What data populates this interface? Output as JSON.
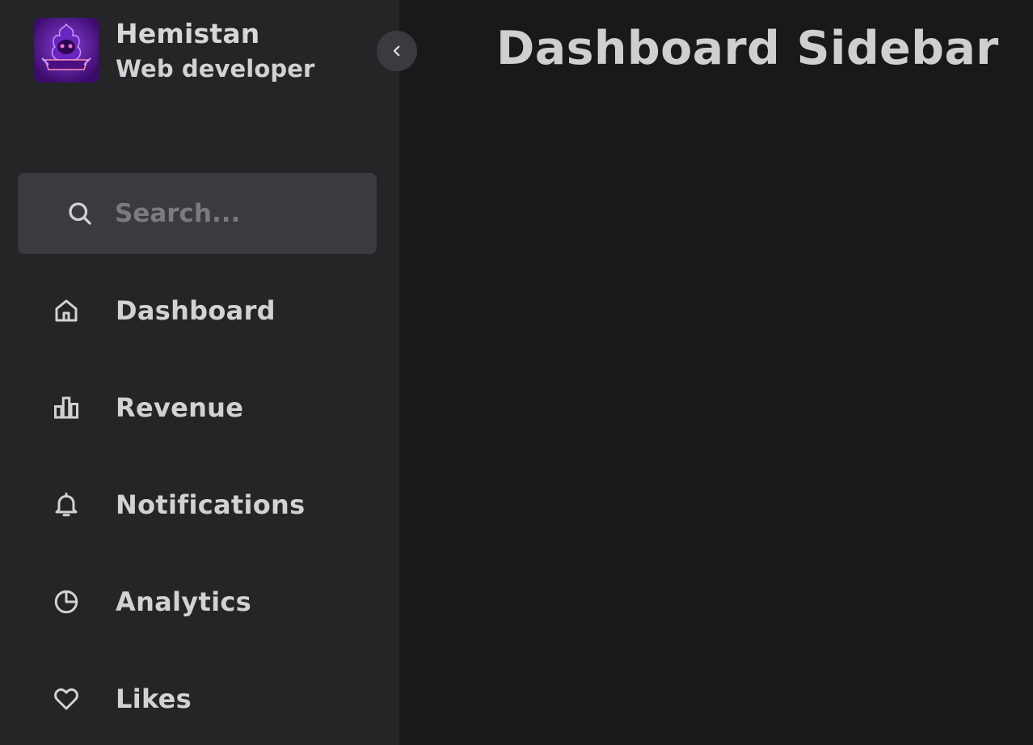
{
  "app": {
    "page_title": "Dashboard Sidebar",
    "accent": "#4a1082",
    "background": "#18191b",
    "sidebar_background": "#242527"
  },
  "sidebar": {
    "profile": {
      "name": "Hemistan",
      "role": "Web developer",
      "logo_icon": "hemistan-logo",
      "logo_text": "Hemistan"
    },
    "collapse_toggle": {
      "icon": "chevron-left-icon"
    },
    "search": {
      "icon": "search-icon",
      "placeholder": "Search...",
      "value": ""
    },
    "items": [
      {
        "label": "Dashboard",
        "icon": "home-icon"
      },
      {
        "label": "Revenue",
        "icon": "bar-chart-icon"
      },
      {
        "label": "Notifications",
        "icon": "bell-icon"
      },
      {
        "label": "Analytics",
        "icon": "pie-chart-icon"
      },
      {
        "label": "Likes",
        "icon": "heart-icon"
      }
    ]
  }
}
